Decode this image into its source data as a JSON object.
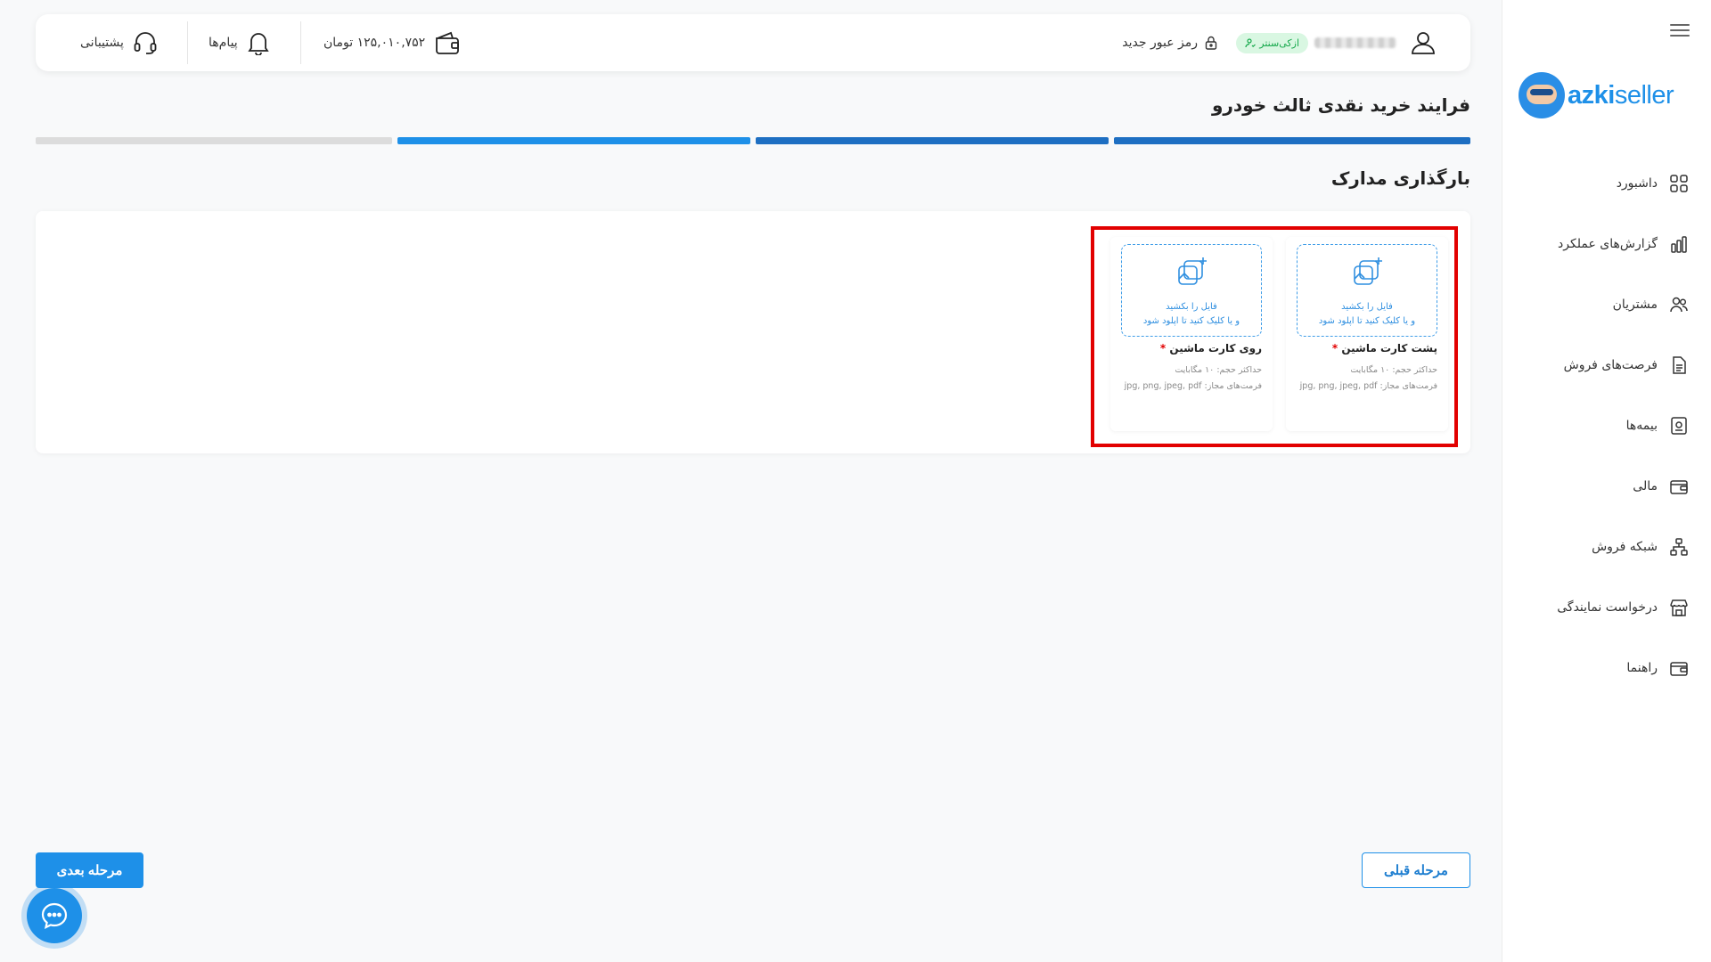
{
  "brand": {
    "logo_azki": "azki",
    "logo_seller": "seller",
    "accent": "#1e90e8"
  },
  "sidebar": {
    "items": [
      {
        "label": "داشبورد",
        "icon": "grid-icon"
      },
      {
        "label": "گزارش‌های عملکرد",
        "icon": "bar-chart-icon"
      },
      {
        "label": "مشتریان",
        "icon": "users-icon"
      },
      {
        "label": "فرصت‌های فروش",
        "icon": "document-icon"
      },
      {
        "label": "بیمه‌ها",
        "icon": "insurance-icon"
      },
      {
        "label": "مالی",
        "icon": "wallet-icon"
      },
      {
        "label": "شبکه فروش",
        "icon": "network-icon"
      },
      {
        "label": "درخواست نمایندگی",
        "icon": "store-icon"
      },
      {
        "label": "راهنما",
        "icon": "guide-icon"
      }
    ]
  },
  "topbar": {
    "user_badge": "ازکی‌سنتر",
    "new_password": "رمز عبور جدید",
    "balance": "۱۲۵,۰۱۰,۷۵۲ تومان",
    "messages": "پیام‌ها",
    "support": "پشتیبانی"
  },
  "page": {
    "title": "فرایند خرید نقدی ثالث خودرو",
    "section_title": "بارگذاری مدارک",
    "steps_total": 4,
    "steps_done": 3
  },
  "uploads": [
    {
      "drop_line1": "فایل را بکشید",
      "drop_line2": "و یا کلیک کنید تا اپلود شود",
      "label": "پشت کارت ماشین",
      "required_mark": "*",
      "max_size": "حداکثر حجم: ۱۰ مگابایت",
      "formats": "فرمت‌های مجاز: jpg, png, jpeg, pdf"
    },
    {
      "drop_line1": "فایل را بکشید",
      "drop_line2": "و یا کلیک کنید تا اپلود شود",
      "label": "روی کارت ماشین",
      "required_mark": "*",
      "max_size": "حداکثر حجم: ۱۰ مگابایت",
      "formats": "فرمت‌های مجاز: jpg, png, jpeg, pdf"
    }
  ],
  "buttons": {
    "next": "مرحله بعدی",
    "prev": "مرحله قبلی"
  }
}
